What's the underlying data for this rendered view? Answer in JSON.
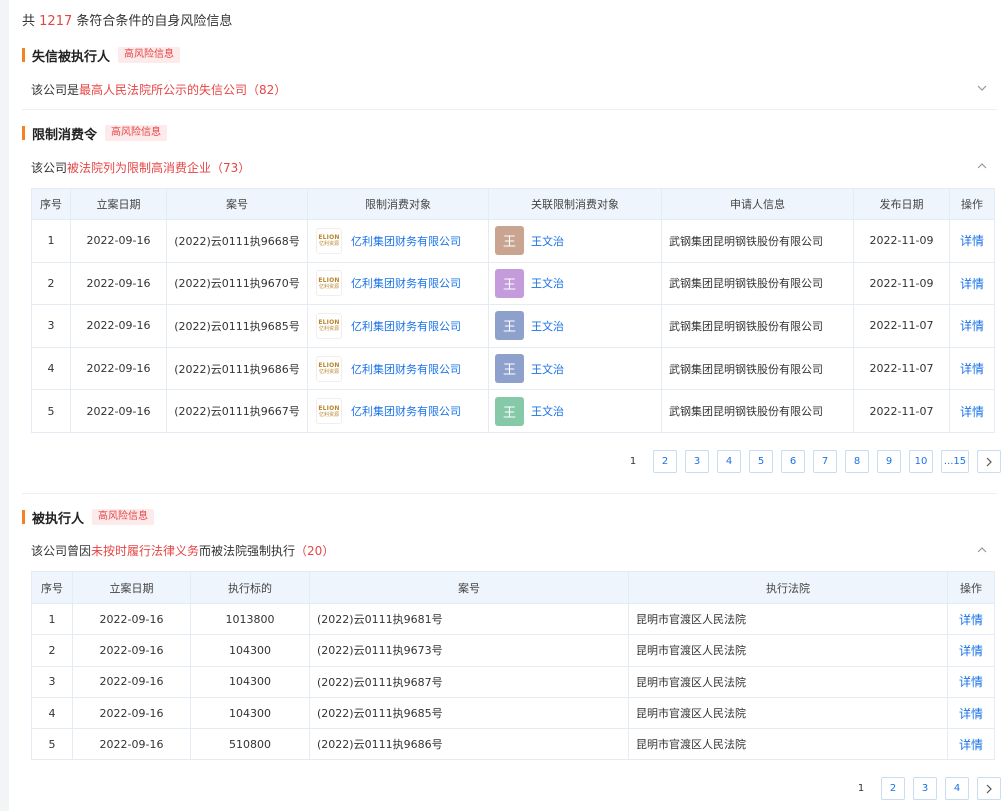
{
  "summary": {
    "prefix": "共",
    "count": "1217",
    "suffix": "条符合条件的自身风险信息"
  },
  "sections": {
    "dishonest": {
      "title": "失信被执行人",
      "badge": "高风险信息",
      "desc_pre": "该公司是",
      "desc_hl": "最高人民法院所公示的失信公司",
      "desc_count": "（82）"
    },
    "restrict": {
      "title": "限制消费令",
      "badge": "高风险信息",
      "desc_pre": "该公司",
      "desc_hl": "被法院列为限制高消费企业",
      "desc_count": "（73）",
      "headers": [
        "序号",
        "立案日期",
        "案号",
        "限制消费对象",
        "关联限制消费对象",
        "申请人信息",
        "发布日期",
        "操作"
      ],
      "logo_top": "ELION",
      "logo_bottom": "亿利资源",
      "rows": [
        {
          "no": "1",
          "date": "2022-09-16",
          "case": "(2022)云0111执9668号",
          "company": "亿利集团财务有限公司",
          "avatar": "王",
          "avatar_color": "#c9a591",
          "person": "王文治",
          "applicant": "武钢集团昆明钢铁股份有限公司",
          "pub": "2022-11-09",
          "op": "详情"
        },
        {
          "no": "2",
          "date": "2022-09-16",
          "case": "(2022)云0111执9670号",
          "company": "亿利集团财务有限公司",
          "avatar": "王",
          "avatar_color": "#c49bdb",
          "person": "王文治",
          "applicant": "武钢集团昆明钢铁股份有限公司",
          "pub": "2022-11-09",
          "op": "详情"
        },
        {
          "no": "3",
          "date": "2022-09-16",
          "case": "(2022)云0111执9685号",
          "company": "亿利集团财务有限公司",
          "avatar": "王",
          "avatar_color": "#8ea1cc",
          "person": "王文治",
          "applicant": "武钢集团昆明钢铁股份有限公司",
          "pub": "2022-11-07",
          "op": "详情"
        },
        {
          "no": "4",
          "date": "2022-09-16",
          "case": "(2022)云0111执9686号",
          "company": "亿利集团财务有限公司",
          "avatar": "王",
          "avatar_color": "#8ea1cc",
          "person": "王文治",
          "applicant": "武钢集团昆明钢铁股份有限公司",
          "pub": "2022-11-07",
          "op": "详情"
        },
        {
          "no": "5",
          "date": "2022-09-16",
          "case": "(2022)云0111执9667号",
          "company": "亿利集团财务有限公司",
          "avatar": "王",
          "avatar_color": "#86c9a8",
          "person": "王文治",
          "applicant": "武钢集团昆明钢铁股份有限公司",
          "pub": "2022-11-07",
          "op": "详情"
        }
      ],
      "pager": [
        "1",
        "2",
        "3",
        "4",
        "5",
        "6",
        "7",
        "8",
        "9",
        "10",
        "...15"
      ]
    },
    "executed": {
      "title": "被执行人",
      "badge": "高风险信息",
      "desc_pre": "该公司曾因",
      "desc_hl": "未按时履行法律义务",
      "desc_post": "而被法院强制执行",
      "desc_count": "（20）",
      "headers": [
        "序号",
        "立案日期",
        "执行标的",
        "案号",
        "执行法院",
        "操作"
      ],
      "rows": [
        {
          "no": "1",
          "date": "2022-09-16",
          "amount": "1013800",
          "case": "(2022)云0111执9681号",
          "court": "昆明市官渡区人民法院",
          "op": "详情"
        },
        {
          "no": "2",
          "date": "2022-09-16",
          "amount": "104300",
          "case": "(2022)云0111执9673号",
          "court": "昆明市官渡区人民法院",
          "op": "详情"
        },
        {
          "no": "3",
          "date": "2022-09-16",
          "amount": "104300",
          "case": "(2022)云0111执9687号",
          "court": "昆明市官渡区人民法院",
          "op": "详情"
        },
        {
          "no": "4",
          "date": "2022-09-16",
          "amount": "104300",
          "case": "(2022)云0111执9685号",
          "court": "昆明市官渡区人民法院",
          "op": "详情"
        },
        {
          "no": "5",
          "date": "2022-09-16",
          "amount": "510800",
          "case": "(2022)云0111执9686号",
          "court": "昆明市官渡区人民法院",
          "op": "详情"
        }
      ],
      "pager": [
        "1",
        "2",
        "3",
        "4"
      ]
    }
  },
  "icons": {
    "collapse": "chevron-down-icon",
    "expand": "chevron-up-icon",
    "next": "chevron-right-icon"
  },
  "colors": {
    "accent": "#f5811f",
    "danger": "#e64545",
    "link": "#1a73e8"
  }
}
